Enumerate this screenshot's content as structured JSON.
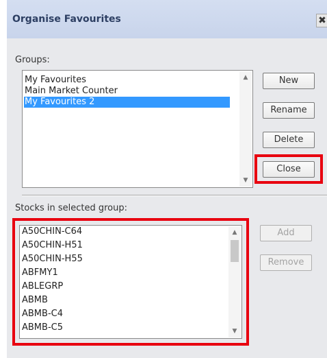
{
  "dialog": {
    "title": "Organise Favourites",
    "close_glyph": "✖"
  },
  "groups": {
    "label": "Groups:",
    "items": [
      {
        "label": "My Favourites",
        "selected": false
      },
      {
        "label": "Main Market Counter",
        "selected": false
      },
      {
        "label": "My Favourites 2",
        "selected": true
      }
    ]
  },
  "buttons": {
    "new": "New",
    "rename": "Rename",
    "delete": "Delete",
    "close": "Close",
    "add": "Add",
    "remove": "Remove"
  },
  "stocks": {
    "label": "Stocks in selected group:",
    "items": [
      "A50CHIN-C64",
      "A50CHIN-H51",
      "A50CHIN-H55",
      "ABFMY1",
      "ABLEGRP",
      "ABMB",
      "ABMB-C4",
      "ABMB-C5"
    ]
  },
  "colors": {
    "highlight": "#e8000f",
    "selection": "#3399ff",
    "title_text": "#2d3f63"
  }
}
